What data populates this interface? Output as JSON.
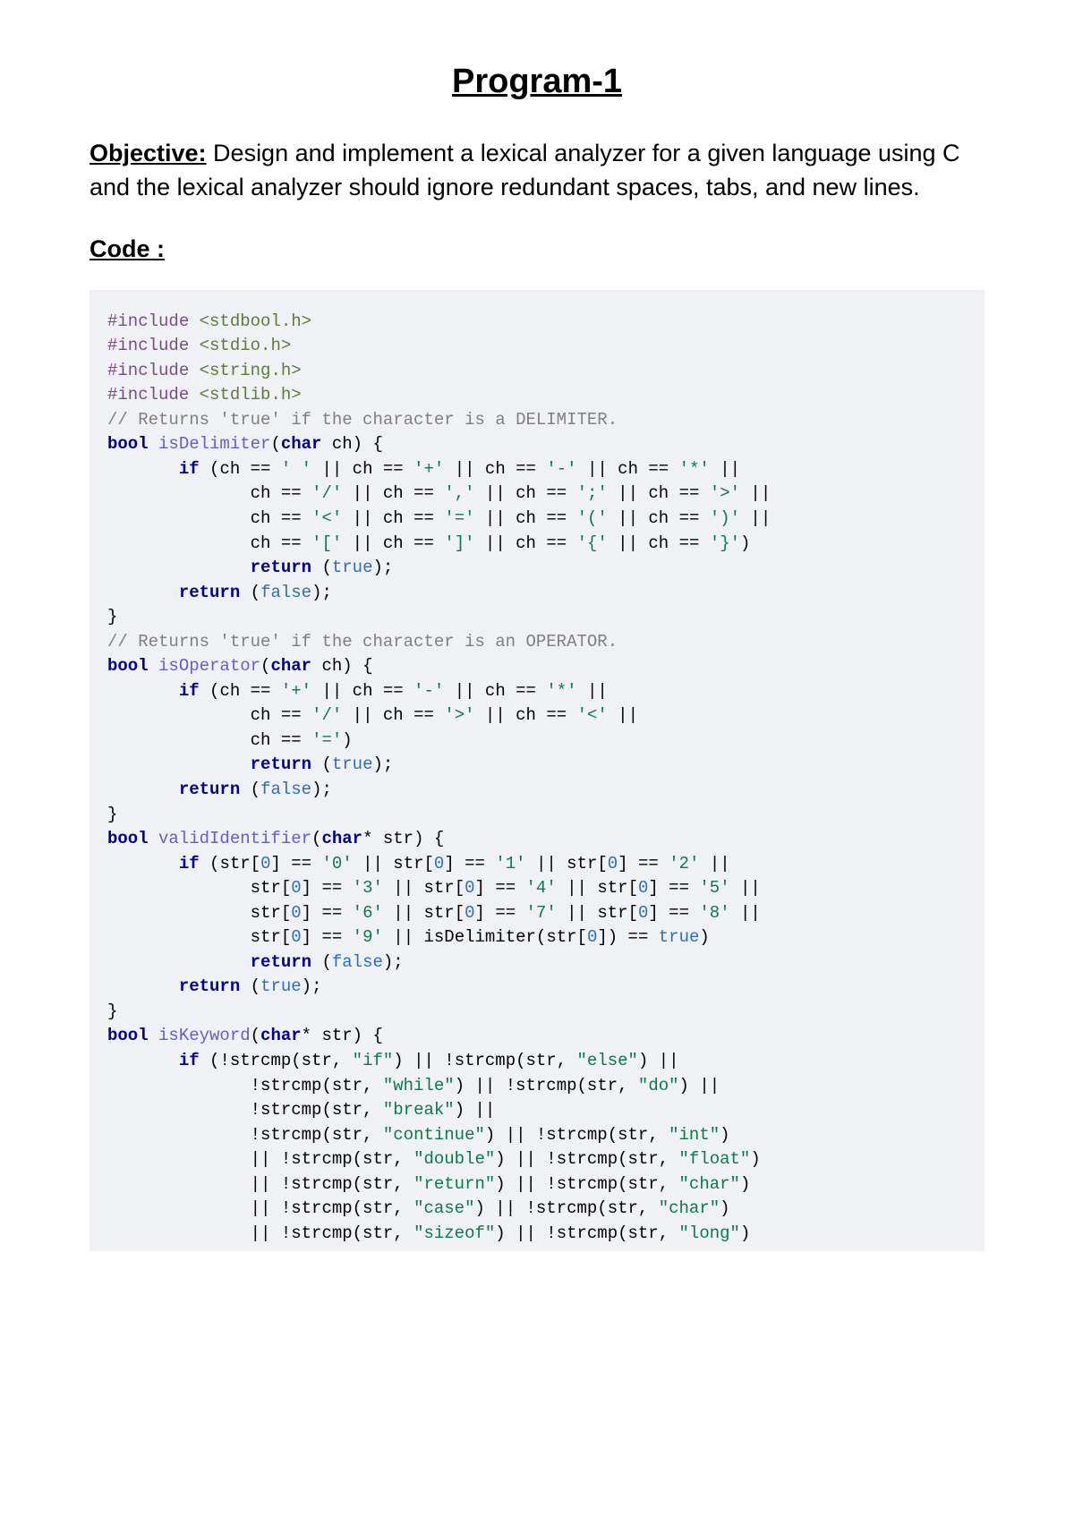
{
  "title": "Program-1",
  "objective_label": "Objective:",
  "objective_text": " Design and implement a lexical analyzer for a given language using C and the lexical analyzer should ignore redundant spaces, tabs, and new lines.",
  "code_heading": "Code :",
  "code": {
    "inc1_a": "#include ",
    "inc1_b": "<stdbool.h>",
    "inc2_a": "#include ",
    "inc2_b": "<stdio.h>",
    "inc3_a": "#include ",
    "inc3_b": "<string.h>",
    "inc4_a": "#include ",
    "inc4_b": "<stdlib.h>",
    "cmt1": "// Returns 'true' if the character is a DELIMITER.",
    "kw_bool": "bool",
    "fn_isDelimiter": "isDelimiter",
    "kw_char": "char",
    "p_ch": " ch) {",
    "kw_if": "if",
    "d_if1": " (ch == ",
    "d_sp": "' '",
    "d_or": " || ch == ",
    "d_plus": "'+'",
    "d_minus": "'-'",
    "d_star": "'*'",
    "d_slash": "'/'",
    "d_comma": "','",
    "d_semi": "';'",
    "d_gt": "'>'",
    "d_lt": "'<'",
    "d_eq": "'='",
    "d_lpar": "'('",
    "d_rpar": "')'",
    "d_lbr": "'['",
    "d_rbr": "']'",
    "d_lcb": "'{'",
    "d_rcb": "'}'",
    "d_close": ")",
    "kw_return": "return",
    "lit_true": "true",
    "lit_false": "false",
    "ret_open": " (",
    "ret_close": ");",
    "brace_close": "}",
    "cmt2": "// Returns 'true' if the character is an OPERATOR.",
    "fn_isOperator": "isOperator",
    "fn_validIdentifier": "validIdentifier",
    "kw_charptr": "char",
    "p_str": "* str) {",
    "vi_if": " (str[",
    "idx0": "0",
    "vi_eq": "] == ",
    "c0": "'0'",
    "vi_or": " || str[",
    "c1": "'1'",
    "c2": "'2'",
    "c3": "'3'",
    "c4": "'4'",
    "c5": "'5'",
    "c6": "'6'",
    "c7": "'7'",
    "c8": "'8'",
    "c9": "'9'",
    "vi_del": " || isDelimiter(str[",
    "vi_del2": "]) == ",
    "fn_isKeyword": "isKeyword",
    "kw_if2": " (!strcmp(str, ",
    "s_if": "\"if\"",
    "kw_or": ") || !strcmp(str, ",
    "s_else": "\"else\"",
    "kw_or2": ") ||",
    "kw_line": "              !strcmp(str, ",
    "s_while": "\"while\"",
    "s_do": "\"do\"",
    "s_break": "\"break\"",
    "s_continue": "\"continue\"",
    "s_int": "\"int\"",
    "kw_line2": "              || !strcmp(str, ",
    "s_double": "\"double\"",
    "s_float": "\"float\"",
    "s_return": "\"return\"",
    "s_char": "\"char\"",
    "s_case": "\"case\"",
    "s_sizeof": "\"sizeof\"",
    "s_long": "\"long\"",
    "eol_or": " ||",
    "eol_par": ")",
    "sp1": " ",
    "op_open": "(",
    "indent8": "       ",
    "indent14": "              ",
    "pre_ch": "ch == "
  }
}
